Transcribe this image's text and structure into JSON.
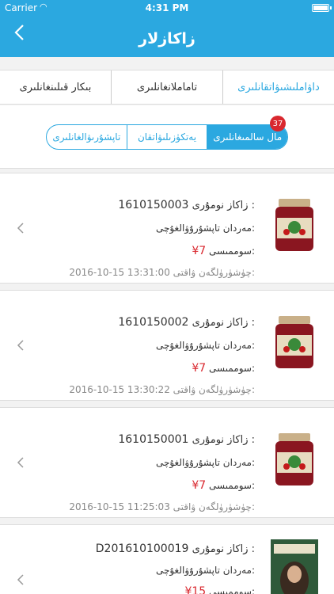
{
  "status": {
    "carrier": "Carrier",
    "time": "4:31 PM"
  },
  "nav": {
    "title": "زاكازلار"
  },
  "tabs": [
    {
      "label": "داۋاملىشىۋاتقانلىرى",
      "active": true
    },
    {
      "label": "تاماملانغانلىرى",
      "active": false
    },
    {
      "label": "بىكار قىلىنغانلىرى",
      "active": false
    }
  ],
  "segments": [
    {
      "label": "تاپشۇرىۋالغانلىرى",
      "active": false
    },
    {
      "label": "يەتكۈزىلىۋاتقان",
      "active": false
    },
    {
      "label": "مال سالمىغانلىرى",
      "active": true,
      "badge": "37"
    }
  ],
  "labels": {
    "order_no": "زاكاز نومۇرى :",
    "receiver": "تاپشۇرۇۋالغۇچى:",
    "receiver_name": "مەردان",
    "total": "سوممىسى:",
    "time": "چۈشۈرۈلگەن ۋاقتى:"
  },
  "orders": [
    {
      "number": "1610150003",
      "price": "¥7",
      "time": "2016-10-15 13:31:00",
      "thumb": "jar"
    },
    {
      "number": "1610150002",
      "price": "¥7",
      "time": "2016-10-15 13:30:22",
      "thumb": "jar"
    },
    {
      "number": "1610150001",
      "price": "¥7",
      "time": "2016-10-15 11:25:03",
      "thumb": "jar"
    },
    {
      "number": "D201610100019",
      "price": "¥15",
      "time": "",
      "thumb": "box"
    }
  ]
}
